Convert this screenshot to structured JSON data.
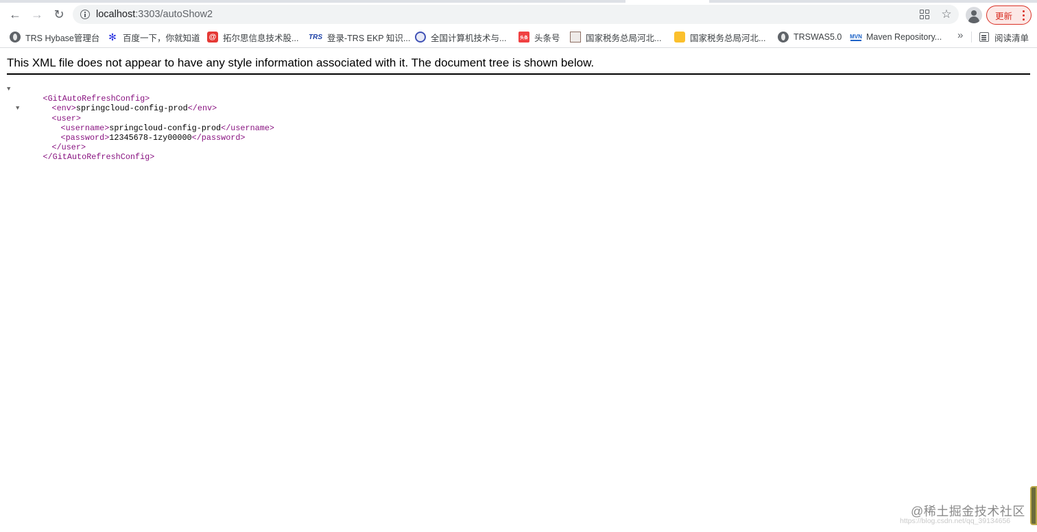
{
  "browser": {
    "url_host": "localhost",
    "url_path": ":3303/autoShow2",
    "update_label": "更新",
    "icons": {
      "back": "back-arrow-icon",
      "forward": "forward-arrow-icon",
      "reload": "reload-icon",
      "site_info": "info-icon",
      "apps": "qr-grid-icon",
      "bookmark": "star-icon",
      "profile": "profile-icon",
      "menu": "kebab-menu-icon"
    },
    "colors": {
      "update_accent": "#d93025",
      "xml_tag": "#881280"
    }
  },
  "bookmarks": {
    "items": [
      {
        "label": "TRS Hybase管理台",
        "icon": "globe-icon"
      },
      {
        "label": "百度一下，你就知道",
        "icon": "baidu-paw-icon"
      },
      {
        "label": "拓尔思信息技术股...",
        "icon": "tuo-icon"
      },
      {
        "label": "登录-TRS EKP 知识...",
        "icon": "trs-icon",
        "icon_text": "TRS"
      },
      {
        "label": "全国计算机技术与...",
        "icon": "computer-exam-icon"
      },
      {
        "label": "头条号",
        "icon": "toutiao-icon",
        "icon_text": "头条"
      },
      {
        "label": "国家税务总局河北...",
        "icon": "tax-icon"
      },
      {
        "label": "国家税务总局河北...",
        "icon": "tax-icon"
      },
      {
        "label": "TRSWAS5.0",
        "icon": "globe-icon"
      },
      {
        "label": "Maven Repository...",
        "icon": "maven-icon",
        "icon_text": "MVN"
      }
    ],
    "more": "»",
    "reading_list": "阅读清单"
  },
  "xml_viewer": {
    "notice": "This XML file does not appear to have any style information associated with it. The document tree is shown below.",
    "root_open": "<GitAutoRefreshConfig>",
    "env_open": "<env>",
    "env_value": "springcloud-config-prod",
    "env_close": "</env>",
    "user_open": "<user>",
    "username_open": "<username>",
    "username_value": "springcloud-config-prod",
    "username_close": "</username>",
    "password_open": "<password>",
    "password_value": "12345678-1zy00000",
    "password_close": "</password>",
    "user_close": "</user>",
    "root_close": "</GitAutoRefreshConfig>"
  },
  "watermark": {
    "text": "@稀土掘金技术社区",
    "url": "https://blog.csdn.net/qq_39134656"
  }
}
